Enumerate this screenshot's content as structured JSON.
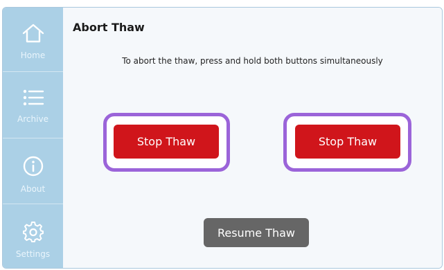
{
  "sidebar": {
    "items": [
      {
        "label": "Home",
        "icon": "home-icon"
      },
      {
        "label": "Archive",
        "icon": "list-icon"
      },
      {
        "label": "About",
        "icon": "info-icon"
      },
      {
        "label": "Settings",
        "icon": "gear-icon"
      }
    ]
  },
  "page": {
    "title": "Abort Thaw",
    "instruction": "To abort the thaw, press and hold both buttons simultaneously"
  },
  "buttons": {
    "stop_left": "Stop Thaw",
    "stop_right": "Stop Thaw",
    "resume": "Resume Thaw"
  },
  "colors": {
    "sidebar_bg": "#abd0e6",
    "stop_red": "#d0151b",
    "highlight_ring": "#9b64d9",
    "resume_gray": "#666666"
  }
}
